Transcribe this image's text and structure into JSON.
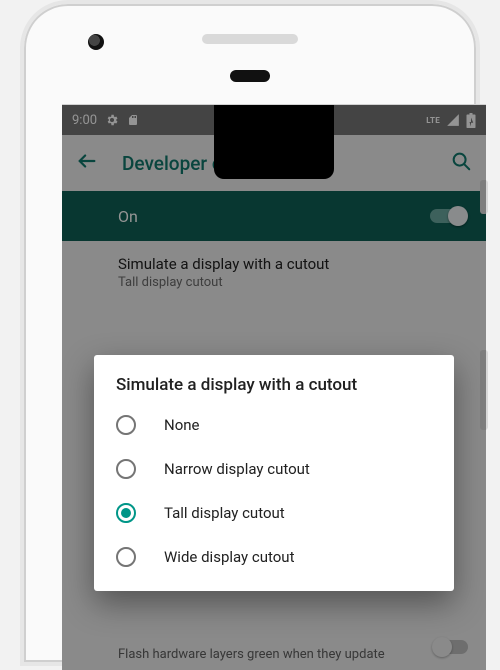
{
  "status": {
    "time": "9:00",
    "lte_label": "LTE"
  },
  "header": {
    "title": "Developer options"
  },
  "master": {
    "label": "On",
    "enabled": true
  },
  "preview_row": {
    "title": "Simulate a display with a cutout",
    "subtitle": "Tall display cutout"
  },
  "dialog": {
    "title": "Simulate a display with a cutout",
    "options": [
      {
        "label": "None",
        "selected": false
      },
      {
        "label": "Narrow display cutout",
        "selected": false
      },
      {
        "label": "Tall display cutout",
        "selected": true
      },
      {
        "label": "Wide display cutout",
        "selected": false
      }
    ]
  },
  "bg_row": {
    "text": "Flash hardware layers green when they update"
  },
  "colors": {
    "accent": "#009688",
    "header_text": "#10786c",
    "toggle_bar": "#0e5f55"
  }
}
